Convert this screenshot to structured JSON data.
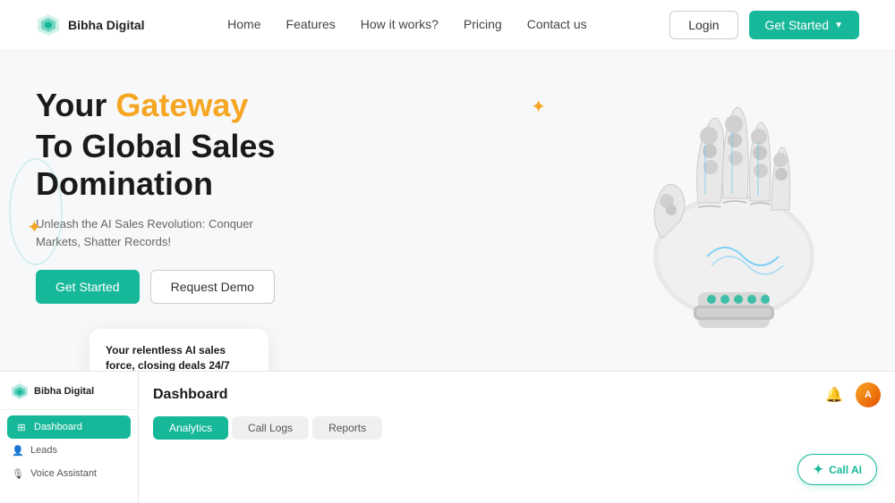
{
  "navbar": {
    "logo_text": "Bibha Digital",
    "links": [
      {
        "label": "Home"
      },
      {
        "label": "Features"
      },
      {
        "label": "How it works?"
      },
      {
        "label": "Pricing"
      },
      {
        "label": "Contact us"
      }
    ],
    "login_label": "Login",
    "get_started_label": "Get Started"
  },
  "hero": {
    "title_prefix": "Your ",
    "title_highlight": "Gateway",
    "title_line2": "To Global Sales Domination",
    "subtitle": "Unleash the AI Sales Revolution: Conquer Markets, Shatter Records!",
    "btn_get_started": "Get Started",
    "btn_request_demo": "Request Demo",
    "card": {
      "title": "Your relentless AI sales force, closing deals 24/7"
    }
  },
  "dashboard": {
    "title": "Dashboard",
    "sidebar": {
      "logo_text": "Bibha Digital",
      "menu_items": [
        {
          "label": "Dashboard",
          "active": true
        },
        {
          "label": "Leads",
          "active": false
        },
        {
          "label": "Voice Assistant",
          "active": false
        }
      ]
    },
    "tabs": [
      {
        "label": "Analytics",
        "active": true
      },
      {
        "label": "Call Logs",
        "active": false
      },
      {
        "label": "Reports",
        "active": false
      }
    ]
  },
  "call_ai": {
    "label": "Call AI"
  }
}
